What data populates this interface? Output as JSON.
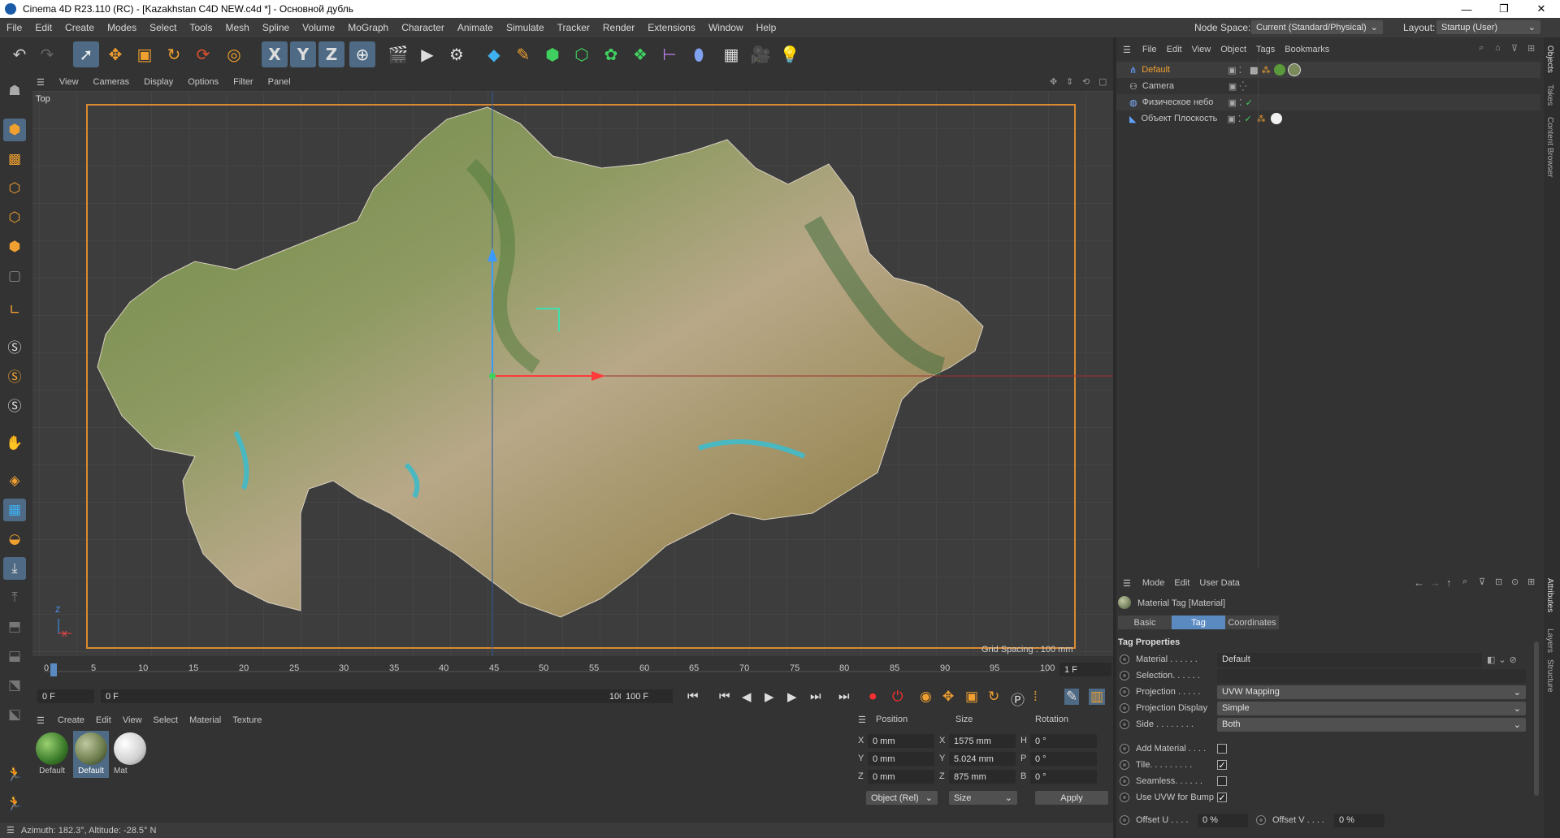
{
  "window": {
    "title": "Cinema 4D R23.110 (RC) - [Kazakhstan C4D NEW.c4d *] - Основной дубль",
    "minimize": "—",
    "maximize": "❐",
    "close": "✕"
  },
  "menu": {
    "items": [
      "File",
      "Edit",
      "Create",
      "Modes",
      "Select",
      "Tools",
      "Mesh",
      "Spline",
      "Volume",
      "MoGraph",
      "Character",
      "Animate",
      "Simulate",
      "Tracker",
      "Render",
      "Extensions",
      "Window",
      "Help"
    ],
    "node_space_label": "Node Space:",
    "node_space_value": "Current (Standard/Physical)",
    "layout_label": "Layout:",
    "layout_value": "Startup (User)"
  },
  "toolbar": {
    "icons": [
      "undo-icon",
      "redo-icon",
      "live-selection-icon",
      "move-icon",
      "scale-icon",
      "rotate-icon",
      "recent-tools-icon",
      "select-object-icon",
      "x-axis-lock-icon",
      "y-axis-lock-icon",
      "z-axis-lock-icon",
      "world-coordinates-icon",
      "render-view-icon",
      "render-picture-viewer-icon",
      "render-settings-icon",
      "cube-icon",
      "pen-spline-icon",
      "subdivision-icon",
      "extrude-icon",
      "cloner-icon",
      "mograph-effector-icon",
      "spline-generator-icon",
      "deformer-icon",
      "floor-icon",
      "camera-icon",
      "light-icon"
    ],
    "axis_labels": [
      "X",
      "Y",
      "Z"
    ]
  },
  "viewport": {
    "menu": [
      "View",
      "Cameras",
      "Display",
      "Options",
      "Filter",
      "Panel"
    ],
    "view_name": "Top",
    "grid_spacing": "Grid Spacing : 100 mm",
    "axis_x": "X",
    "axis_z": "Z"
  },
  "timeline": {
    "ticks": [
      "0",
      "5",
      "10",
      "15",
      "20",
      "25",
      "30",
      "35",
      "40",
      "45",
      "50",
      "55",
      "60",
      "65",
      "70",
      "75",
      "80",
      "85",
      "90",
      "95",
      "100"
    ],
    "current_frame": "1 F",
    "start_frame": "0 F",
    "range_start": "0 F",
    "range_end": "100 F",
    "end_frame": "100 F"
  },
  "material_manager": {
    "menu": [
      "Create",
      "Edit",
      "View",
      "Select",
      "Material",
      "Texture"
    ],
    "materials": [
      {
        "name": "Default",
        "color": "#5a9a3a",
        "selected": false
      },
      {
        "name": "Default",
        "color": "#7a8a5a",
        "selected": true
      },
      {
        "name": "Mat",
        "color": "#e8e8e8",
        "selected": false
      }
    ]
  },
  "coordinates": {
    "headers": [
      "Position",
      "Size",
      "Rotation"
    ],
    "rows": [
      {
        "axis": "X",
        "pos": "0 mm",
        "size_axis": "X",
        "size": "1575 mm",
        "rot_axis": "H",
        "rot": "0 °"
      },
      {
        "axis": "Y",
        "pos": "0 mm",
        "size_axis": "Y",
        "size": "5.024 mm",
        "rot_axis": "P",
        "rot": "0 °"
      },
      {
        "axis": "Z",
        "pos": "0 mm",
        "size_axis": "Z",
        "size": "875 mm",
        "rot_axis": "B",
        "rot": "0 °"
      }
    ],
    "mode": "Object (Rel)",
    "size_mode": "Size",
    "apply": "Apply"
  },
  "status": {
    "text": "Azimuth: 182.3°, Altitude: -28.5°  N"
  },
  "object_manager": {
    "menu": [
      "File",
      "Edit",
      "View",
      "Object",
      "Tags",
      "Bookmarks"
    ],
    "objects": [
      {
        "name": "Default",
        "highlight": true
      },
      {
        "name": "Camera",
        "highlight": false
      },
      {
        "name": "Физическое небо",
        "highlight": false
      },
      {
        "name": "Объект Плоскость",
        "highlight": false
      }
    ]
  },
  "attribute_manager": {
    "menu": [
      "Mode",
      "Edit",
      "User Data"
    ],
    "title": "Material Tag [Material]",
    "tabs": [
      "Basic",
      "Tag",
      "Coordinates"
    ],
    "active_tab": "Tag",
    "section": "Tag Properties",
    "props": {
      "material_label": "Material . . . . . .",
      "material_value": "Default",
      "selection_label": "Selection. . . . . .",
      "projection_label": "Projection . . . . .",
      "projection_value": "UVW Mapping",
      "projection_display_label": "Projection Display",
      "projection_display_value": "Simple",
      "side_label": "Side . . . . . . . .",
      "side_value": "Both",
      "add_material_label": "Add Material . . . .",
      "tile_label": "Tile. . . . . . . . .",
      "seamless_label": "Seamless. . . . . .",
      "use_uvw_label": "Use UVW for Bump",
      "offset_u_label": "Offset U . . . .",
      "offset_u_value": "0 %",
      "offset_v_label": "Offset V . . . .",
      "offset_v_value": "0 %"
    },
    "checks": {
      "add_material": false,
      "tile": true,
      "seamless": false,
      "use_uvw": true
    }
  },
  "side_tabs": [
    "Objects",
    "Takes",
    "Content Browser",
    "Attributes",
    "Layers",
    "Structure"
  ]
}
